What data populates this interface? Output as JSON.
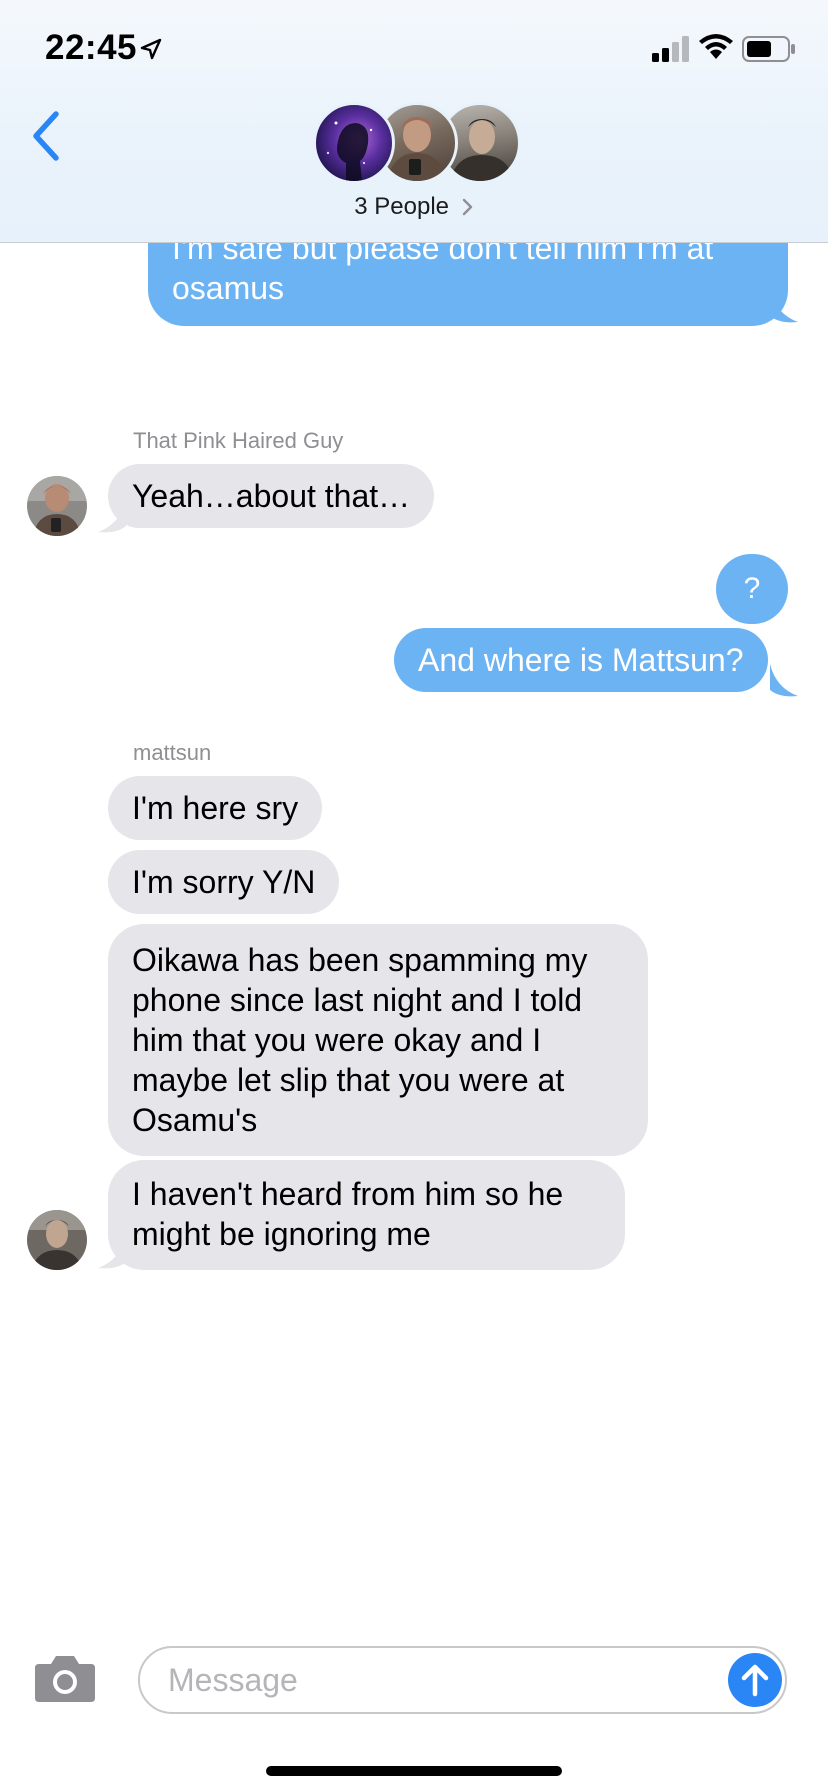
{
  "status_bar": {
    "time": "22:45",
    "icons": [
      "location-arrow-icon",
      "signal-icon",
      "wifi-icon",
      "battery-icon"
    ]
  },
  "header": {
    "back_icon": "chevron-left-icon",
    "participants_label": "3 People",
    "participants_chevron": "chevron-right-icon"
  },
  "colors": {
    "sent_bubble": "#6cb3f4",
    "received_bubble": "#e5e5ea",
    "accent": "#2b86f5"
  },
  "messages": [
    {
      "direction": "sent",
      "text": "I'm safe but please don't tell him I'm at osamus"
    },
    {
      "direction": "received",
      "sender": "That Pink Haired Guy",
      "text": "Yeah…about that…"
    },
    {
      "direction": "sent",
      "text": "?"
    },
    {
      "direction": "sent",
      "text": "And where is Mattsun?"
    },
    {
      "direction": "received",
      "sender": "mattsun",
      "text": "I'm here sry"
    },
    {
      "direction": "received",
      "sender": "mattsun",
      "text": "I'm sorry Y/N"
    },
    {
      "direction": "received",
      "sender": "mattsun",
      "text": "Oikawa has been spamming my phone since last night and I told him that you were okay and I maybe let slip that you were at Osamu's"
    },
    {
      "direction": "received",
      "sender": "mattsun",
      "text": "I haven't heard from him so he might be ignoring me"
    }
  ],
  "composer": {
    "camera_icon": "camera-icon",
    "placeholder": "Message",
    "send_icon": "arrow-up-icon"
  }
}
